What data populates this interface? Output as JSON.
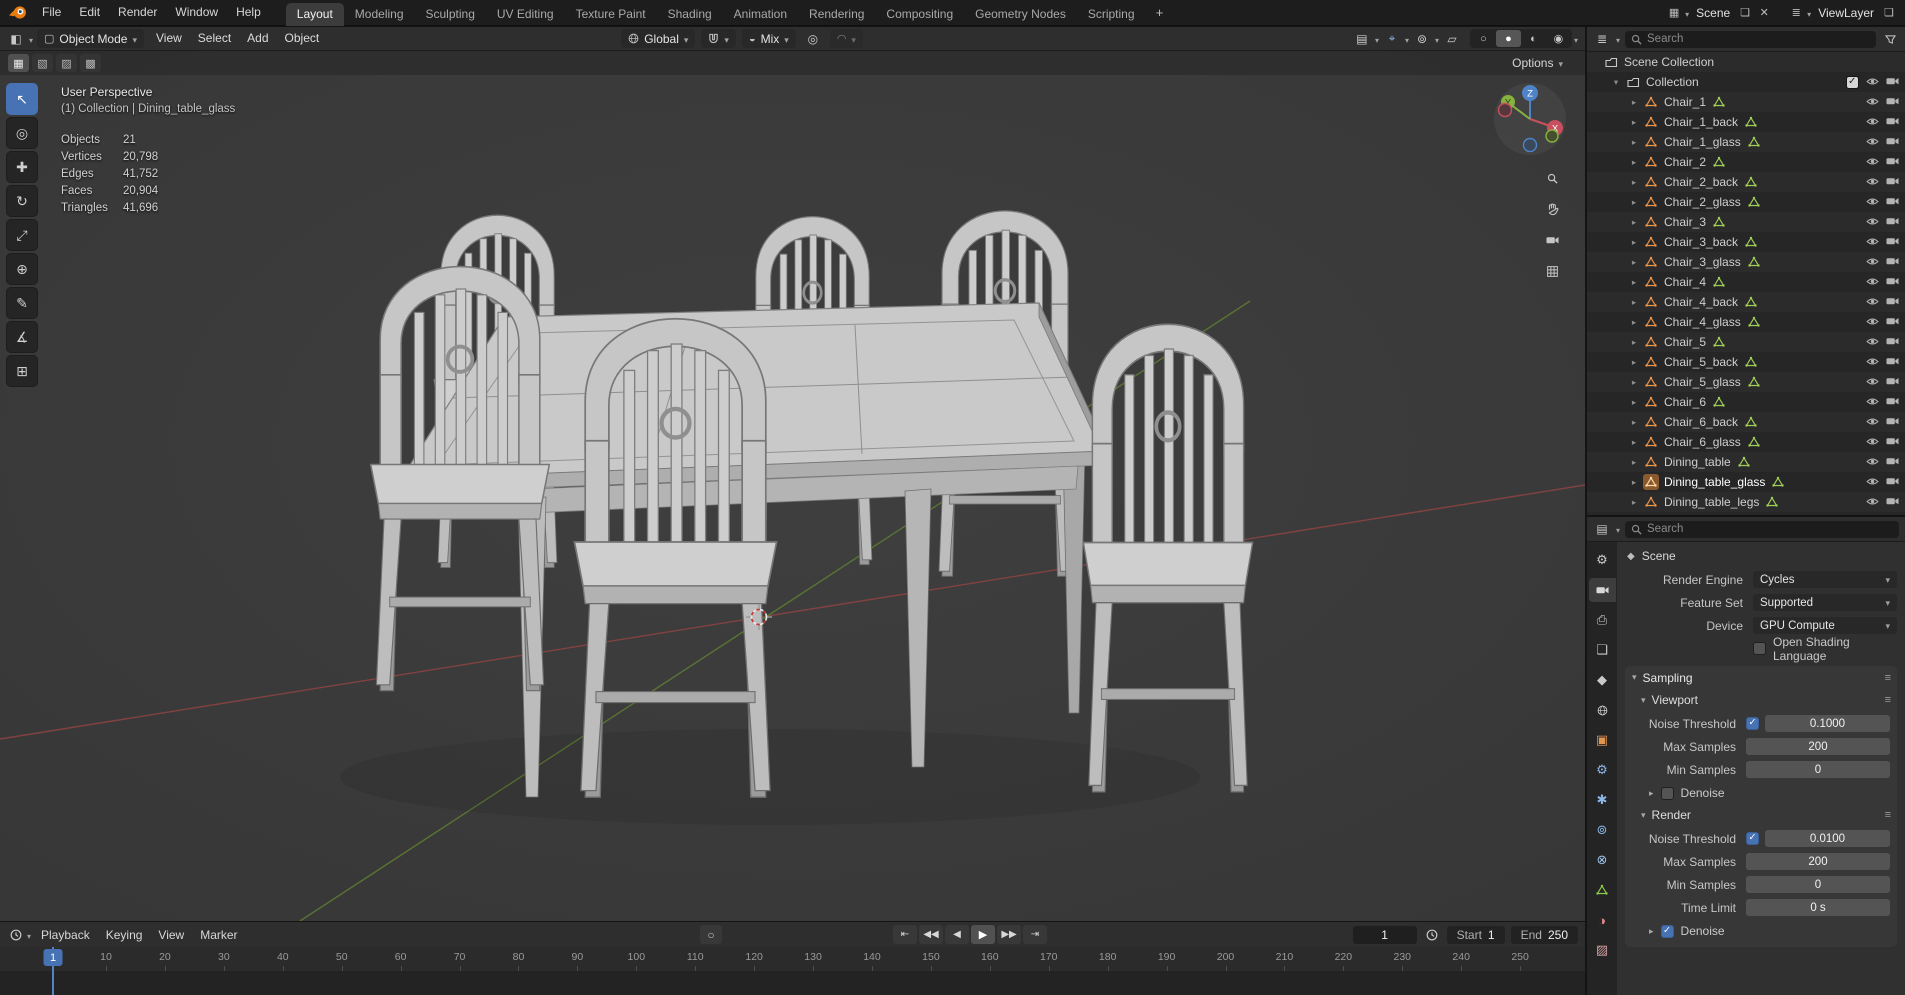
{
  "topbar": {
    "menus": [
      "File",
      "Edit",
      "Render",
      "Window",
      "Help"
    ],
    "workspaces": [
      "Layout",
      "Modeling",
      "Sculpting",
      "UV Editing",
      "Texture Paint",
      "Shading",
      "Animation",
      "Rendering",
      "Compositing",
      "Geometry Nodes",
      "Scripting"
    ],
    "active_workspace": "Layout",
    "add_workspace": "+",
    "scene_name": "Scene",
    "viewlayer_name": "ViewLayer"
  },
  "viewport_header": {
    "mode": "Object Mode",
    "menus": [
      "View",
      "Select",
      "Add",
      "Object"
    ],
    "orientation": "Global",
    "mix": "Mix",
    "options": "Options"
  },
  "tool_settings_modes": [
    {
      "name": "select-mode-set",
      "glyph": "▦"
    },
    {
      "name": "select-mode-extend",
      "glyph": "▧"
    },
    {
      "name": "select-mode-subtract",
      "glyph": "▨"
    },
    {
      "name": "select-mode-intersect",
      "glyph": "▩"
    }
  ],
  "tools": [
    {
      "name": "select-box",
      "glyph": "↖",
      "active": true
    },
    {
      "name": "cursor",
      "glyph": "◎"
    },
    {
      "name": "move",
      "glyph": "✚"
    },
    {
      "name": "rotate",
      "glyph": "↻"
    },
    {
      "name": "scale",
      "glyph": "⤢"
    },
    {
      "name": "transform",
      "glyph": "⊕"
    },
    {
      "name": "annotate",
      "glyph": "✎"
    },
    {
      "name": "measure",
      "glyph": "∡"
    },
    {
      "name": "add-cube",
      "glyph": "⊞"
    }
  ],
  "shading_modes": [
    {
      "name": "wireframe",
      "glyph": "○"
    },
    {
      "name": "solid",
      "glyph": "●",
      "active": true
    },
    {
      "name": "material-preview",
      "glyph": "◐"
    },
    {
      "name": "rendered",
      "glyph": "◉"
    }
  ],
  "icons": {
    "editor-3d": "◧",
    "mode-object": "▢",
    "visibility": "▤",
    "gizmos": "⌖",
    "overlays": "⊚",
    "xray": "▱",
    "proportional": "◎",
    "falloff": "◠",
    "mix": "◒",
    "scene-block": "▦",
    "viewlayer": "≣",
    "duplicate": "❏",
    "delete": "✕",
    "outliner-editor": "≣",
    "properties-editor": "▤",
    "menu-lines": "≡",
    "scene-breadcrumb": "◆",
    "autokey": "○"
  },
  "viewport_overlay": {
    "perspective": "User Perspective",
    "context": "(1) Collection | Dining_table_glass",
    "stats": [
      {
        "label": "Objects",
        "value": "21"
      },
      {
        "label": "Vertices",
        "value": "20,798"
      },
      {
        "label": "Edges",
        "value": "41,752"
      },
      {
        "label": "Faces",
        "value": "20,904"
      },
      {
        "label": "Triangles",
        "value": "41,696"
      }
    ],
    "axis_labels": {
      "x": "X",
      "y": "Y",
      "z": "Z"
    }
  },
  "outliner": {
    "search_placeholder": "Search",
    "root": "Scene Collection",
    "collection": "Collection",
    "collection_checked": true,
    "items": [
      "Chair_1",
      "Chair_1_back",
      "Chair_1_glass",
      "Chair_2",
      "Chair_2_back",
      "Chair_2_glass",
      "Chair_3",
      "Chair_3_back",
      "Chair_3_glass",
      "Chair_4",
      "Chair_4_back",
      "Chair_4_glass",
      "Chair_5",
      "Chair_5_back",
      "Chair_5_glass",
      "Chair_6",
      "Chair_6_back",
      "Chair_6_glass",
      "Dining_table",
      "Dining_table_glass",
      "Dining_table_legs"
    ],
    "active_item": "Dining_table_glass"
  },
  "properties": {
    "search_placeholder": "Search",
    "breadcrumb": "Scene",
    "render_engine": {
      "label": "Render Engine",
      "value": "Cycles"
    },
    "feature_set": {
      "label": "Feature Set",
      "value": "Supported"
    },
    "device": {
      "label": "Device",
      "value": "GPU Compute"
    },
    "osl": {
      "label": "Open Shading Language",
      "checked": false
    },
    "sampling_title": "Sampling",
    "viewport_section": {
      "title": "Viewport",
      "noise_threshold_label": "Noise Threshold",
      "noise_threshold_value": "0.1000",
      "noise_threshold_checked": true,
      "max_samples_label": "Max Samples",
      "max_samples_value": "200",
      "min_samples_label": "Min Samples",
      "min_samples_value": "0",
      "denoise_label": "Denoise",
      "denoise_checked": false
    },
    "render_section": {
      "title": "Render",
      "noise_threshold_label": "Noise Threshold",
      "noise_threshold_value": "0.0100",
      "noise_threshold_checked": true,
      "max_samples_label": "Max Samples",
      "max_samples_value": "200",
      "min_samples_label": "Min Samples",
      "min_samples_value": "0",
      "time_limit_label": "Time Limit",
      "time_limit_value": "0 s",
      "denoise_label": "Denoise",
      "denoise_checked": true
    }
  },
  "property_tabs": [
    {
      "name": "tool",
      "glyph": "⚙",
      "color": "#c9c9c9"
    },
    {
      "name": "render",
      "icon": "camera",
      "color": "#d8d8d8",
      "active": true
    },
    {
      "name": "output",
      "glyph": "⎙",
      "color": "#c9c9c9"
    },
    {
      "name": "view-layer",
      "glyph": "❏",
      "color": "#c9c9c9"
    },
    {
      "name": "scene",
      "glyph": "◆",
      "color": "#c9c9c9"
    },
    {
      "name": "world",
      "icon": "globe",
      "color": "#c9c9c9"
    },
    {
      "name": "object",
      "glyph": "▣",
      "color": "#e09553"
    },
    {
      "name": "modifiers",
      "glyph": "⚙",
      "color": "#8bb8e8"
    },
    {
      "name": "particles",
      "glyph": "✱",
      "color": "#8bb8e8"
    },
    {
      "name": "physics",
      "glyph": "⊚",
      "color": "#8bb8e8"
    },
    {
      "name": "constraints",
      "glyph": "⊗",
      "color": "#9fc3e8"
    },
    {
      "name": "object-data",
      "icon": "mesh",
      "color": "#8ac74a"
    },
    {
      "name": "material",
      "glyph": "◑",
      "color": "#e08a8a"
    },
    {
      "name": "texture",
      "glyph": "▨",
      "color": "#d8a0a0"
    }
  ],
  "timeline": {
    "menus": [
      "Playback",
      "Keying",
      "View",
      "Marker"
    ],
    "current_frame": "1",
    "start_label": "Start",
    "start_value": "1",
    "end_label": "End",
    "end_value": "250",
    "ticks": [
      1,
      10,
      20,
      30,
      40,
      50,
      60,
      70,
      80,
      90,
      100,
      110,
      120,
      130,
      140,
      150,
      160,
      170,
      180,
      190,
      200,
      210,
      220,
      230,
      240,
      250
    ],
    "transport": [
      {
        "name": "jump-to-start",
        "glyph": "⇤"
      },
      {
        "name": "prev-keyframe",
        "glyph": "◀◀"
      },
      {
        "name": "play-reverse",
        "glyph": "◀"
      },
      {
        "name": "play",
        "glyph": "▶"
      },
      {
        "name": "next-keyframe",
        "glyph": "▶▶"
      },
      {
        "name": "jump-to-end",
        "glyph": "⇥"
      }
    ]
  },
  "colors": {
    "accent_blue": "#4772b3",
    "axis_x": "#8a4343",
    "axis_y": "#5d7a33",
    "active_object_icon": "#8a5a2e"
  }
}
